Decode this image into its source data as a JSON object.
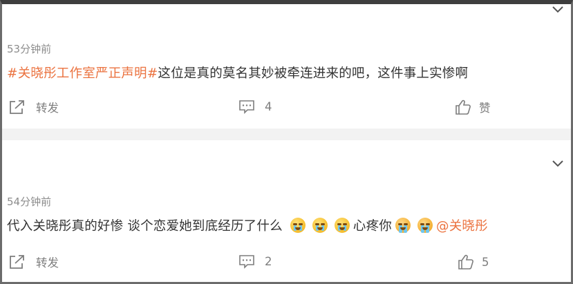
{
  "comments": [
    {
      "time": "53分钟前",
      "hashtag": "#关晓彤工作室严正声明#",
      "text": "这位是真的莫名其妙被牵连进来的吧，这件事上实惨啊",
      "actions": {
        "repost": "转发",
        "comments": "4",
        "like": "赞"
      }
    },
    {
      "time": "54分钟前",
      "text_before": "代入关晓彤真的好惨 谈个恋爱她到底经历了什么",
      "emojis_a": [
        "crying-emoji",
        "crying-emoji",
        "crying-emoji"
      ],
      "text_middle": "心疼你",
      "emojis_b": [
        "sobbing-emoji",
        "sobbing-emoji"
      ],
      "mention": "@关晓彤",
      "actions": {
        "repost": "转发",
        "comments": "2",
        "like": "5"
      }
    }
  ],
  "colors": {
    "accent": "#eb7340",
    "text": "#333333",
    "muted": "#8c8c8c",
    "separator": "#f2f2f2"
  },
  "icons": [
    "chevron-down-icon",
    "share-icon",
    "comment-icon",
    "thumbs-up-icon"
  ]
}
